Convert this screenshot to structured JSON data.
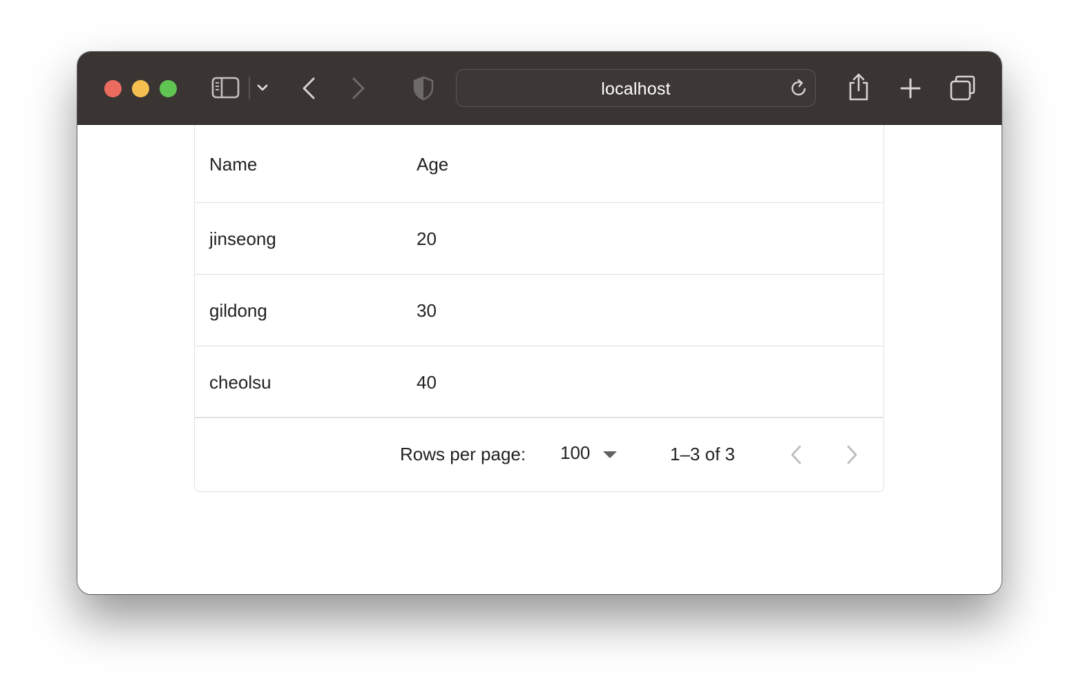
{
  "browser": {
    "url": "localhost",
    "traffic_lights": {
      "close": "#ed6a5e",
      "minimize": "#f5bf4f",
      "zoom": "#61c554"
    },
    "icons": [
      "sidebar-icon",
      "chevron-down-icon",
      "back-icon",
      "forward-icon",
      "shield-icon",
      "reload-icon",
      "share-icon",
      "new-tab-icon",
      "tabs-overview-icon"
    ]
  },
  "grid": {
    "columns": [
      "Name",
      "Age"
    ],
    "rows": [
      {
        "name": "jinseong",
        "age": "20"
      },
      {
        "name": "gildong",
        "age": "30"
      },
      {
        "name": "cheolsu",
        "age": "40"
      }
    ],
    "pagination": {
      "rows_per_page_label": "Rows per page:",
      "rows_per_page_value": "100",
      "range_text": "1–3 of 3"
    }
  }
}
